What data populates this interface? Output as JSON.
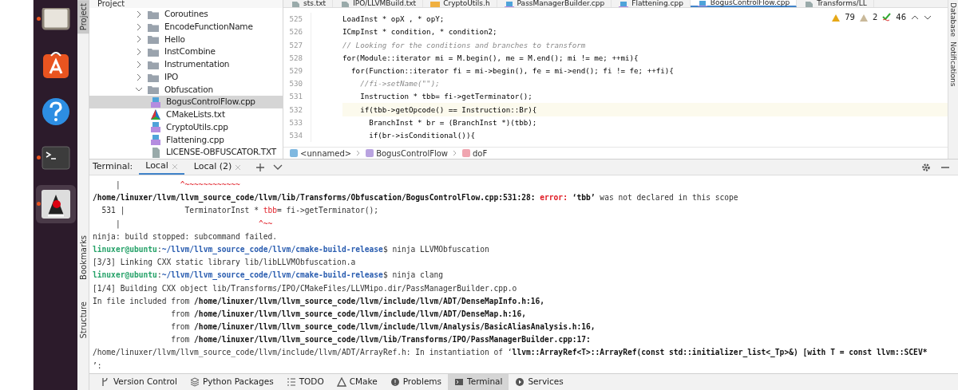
{
  "dock": {
    "items": [
      {
        "kind": "files",
        "running": true,
        "selected": false
      },
      {
        "kind": "store",
        "running": false,
        "selected": false
      },
      {
        "kind": "help",
        "running": false,
        "selected": false
      },
      {
        "kind": "terminal",
        "running": true,
        "selected": false
      },
      {
        "kind": "java",
        "running": true,
        "selected": true
      }
    ]
  },
  "side_strip": {
    "top": [
      {
        "label": "Project",
        "selected": true
      }
    ],
    "bottom": [
      {
        "label": "Bookmarks",
        "selected": false
      },
      {
        "label": "Structure",
        "selected": false
      }
    ]
  },
  "project": {
    "title": "Project",
    "tree": [
      {
        "label": "Coroutines",
        "kind": "folder",
        "expanded": false,
        "selected": false
      },
      {
        "label": "EncodeFunctionName",
        "kind": "folder",
        "expanded": false,
        "selected": false
      },
      {
        "label": "Hello",
        "kind": "folder",
        "expanded": false,
        "selected": false
      },
      {
        "label": "InstCombine",
        "kind": "folder",
        "expanded": false,
        "selected": false
      },
      {
        "label": "Instrumentation",
        "kind": "folder",
        "expanded": false,
        "selected": false
      },
      {
        "label": "IPO",
        "kind": "folder",
        "expanded": false,
        "selected": false
      },
      {
        "label": "Obfuscation",
        "kind": "folder",
        "expanded": true,
        "selected": false,
        "children": [
          {
            "label": "BogusControlFlow.cpp",
            "kind": "cpp",
            "selected": true
          },
          {
            "label": "CMakeLists.txt",
            "kind": "cmake",
            "selected": false
          },
          {
            "label": "CryptoUtils.cpp",
            "kind": "cpp",
            "selected": false
          },
          {
            "label": "Flattening.cpp",
            "kind": "cpp",
            "selected": false
          },
          {
            "label": "LICENSE-OBFUSCATOR.TXT",
            "kind": "text",
            "selected": false
          }
        ]
      }
    ]
  },
  "editor": {
    "tabs": [
      {
        "label": "sts.txt",
        "kind": "text",
        "selected": false
      },
      {
        "label": "IPO/LLVMBuild.txt",
        "kind": "text",
        "selected": false
      },
      {
        "label": "CryptoUtils.h",
        "kind": "h",
        "selected": false
      },
      {
        "label": "PassManagerBuilder.cpp",
        "kind": "cpp",
        "selected": false
      },
      {
        "label": "Flattening.cpp",
        "kind": "cpp",
        "selected": false
      },
      {
        "label": "BogusControlFlow.cpp",
        "kind": "cpp",
        "selected": true
      },
      {
        "label": "Transforms/LL",
        "kind": "text",
        "selected": false
      }
    ],
    "inspections": {
      "warnings": "79",
      "weak_warnings": "2",
      "typos": "46"
    },
    "lines": [
      {
        "number": "525",
        "text": "LoadInst * opX , * opY;",
        "kind": "code",
        "current": false
      },
      {
        "number": "526",
        "text": "ICmpInst * condition, * condition2;",
        "kind": "code",
        "current": false
      },
      {
        "number": "527",
        "text": "// Looking for the conditions and branches to transform",
        "kind": "comment",
        "current": false
      },
      {
        "number": "528",
        "text": "for(Module::iterator mi = M.begin(), me = M.end(); mi != me; ++mi){",
        "kind": "code",
        "current": false
      },
      {
        "number": "529",
        "text": "  for(Function::iterator fi = mi->begin(), fe = mi->end(); fi != fe; ++fi){",
        "kind": "code",
        "current": false
      },
      {
        "number": "530",
        "text": "    //fi->setName(\"\");",
        "kind": "comment",
        "current": false
      },
      {
        "number": "531",
        "text": "    Instruction * tbb= fi->getTerminator();",
        "kind": "code",
        "current": false
      },
      {
        "number": "532",
        "text": "    if(tbb->getOpcode() == Instruction::Br){",
        "kind": "code",
        "current": true
      },
      {
        "number": "533",
        "text": "      BranchInst * br = (BranchInst *)(tbb);",
        "kind": "code",
        "current": false
      },
      {
        "number": "534",
        "text": "      if(br->isConditional()){",
        "kind": "code",
        "current": false
      }
    ],
    "breadcrumbs": [
      {
        "label": "<unnamed>",
        "kind": "namespace"
      },
      {
        "label": "BogusControlFlow",
        "kind": "struct"
      },
      {
        "label": "doF",
        "kind": "function"
      }
    ]
  },
  "right_strip": [
    "Database",
    "Notifications"
  ],
  "terminal": {
    "title": "Terminal:",
    "tabs": [
      {
        "label": "Local",
        "selected": true
      },
      {
        "label": "Local (2)",
        "selected": false
      }
    ],
    "lines": [
      [
        {
          "text": "     |             ",
          "kind": "plain"
        },
        {
          "text": "^~~~~~~~~~~~~",
          "kind": "error"
        }
      ],
      [
        {
          "text": "/home/linuxer/llvm/llvm_source_code/llvm/lib/Transforms/Obfuscation/BogusControlFlow.cpp:531:28: ",
          "kind": "bold"
        },
        {
          "text": "error: ",
          "kind": "error-bold"
        },
        {
          "text": "‘tbb’",
          "kind": "bold"
        },
        {
          "text": " was not declared in this scope",
          "kind": "plain"
        }
      ],
      [
        {
          "text": "  531 |             TerminatorInst * ",
          "kind": "plain"
        },
        {
          "text": "tbb",
          "kind": "error"
        },
        {
          "text": "= fi->getTerminator();",
          "kind": "plain"
        }
      ],
      [
        {
          "text": "     |                              ",
          "kind": "plain"
        },
        {
          "text": "^~~",
          "kind": "error"
        }
      ],
      [
        {
          "text": "ninja: build stopped: subcommand failed.",
          "kind": "plain"
        }
      ],
      [
        {
          "text": "linuxer@ubuntu",
          "kind": "user"
        },
        {
          "text": ":",
          "kind": "plain"
        },
        {
          "text": "~/llvm/llvm_source_code/llvm/cmake-build-release",
          "kind": "path"
        },
        {
          "text": "$ ninja LLVMObfuscation",
          "kind": "plain"
        }
      ],
      [
        {
          "text": "[3/3] Linking CXX static library lib/libLLVMObfuscation.a",
          "kind": "plain"
        }
      ],
      [
        {
          "text": "linuxer@ubuntu",
          "kind": "user"
        },
        {
          "text": ":",
          "kind": "plain"
        },
        {
          "text": "~/llvm/llvm_source_code/llvm/cmake-build-release",
          "kind": "path"
        },
        {
          "text": "$ ninja clang",
          "kind": "plain"
        }
      ],
      [
        {
          "text": "[1/4] Building CXX object lib/Transforms/IPO/CMakeFiles/LLVMipo.dir/PassManagerBuilder.cpp.o",
          "kind": "plain"
        }
      ],
      [
        {
          "text": "In file included from ",
          "kind": "plain"
        },
        {
          "text": "/home/linuxer/llvm/llvm_source_code/llvm/include/llvm/ADT/DenseMapInfo.h:16,",
          "kind": "bold"
        }
      ],
      [
        {
          "text": "                 from ",
          "kind": "plain"
        },
        {
          "text": "/home/linuxer/llvm/llvm_source_code/llvm/include/llvm/ADT/DenseMap.h:16,",
          "kind": "bold"
        }
      ],
      [
        {
          "text": "                 from ",
          "kind": "plain"
        },
        {
          "text": "/home/linuxer/llvm/llvm_source_code/llvm/include/llvm/Analysis/BasicAliasAnalysis.h:16,",
          "kind": "bold"
        }
      ],
      [
        {
          "text": "                 from ",
          "kind": "plain"
        },
        {
          "text": "/home/linuxer/llvm/llvm_source_code/llvm/lib/Transforms/IPO/PassManagerBuilder.cpp:17:",
          "kind": "bold"
        }
      ],
      [
        {
          "text": "/home/linuxer/llvm/llvm_source_code/llvm/include/llvm/ADT/ArrayRef.h: In instantiation of ‘",
          "kind": "plain"
        },
        {
          "text": "llvm::ArrayRef<T>::ArrayRef(const std::initializer_list<_Tp>&) [with T = const llvm::SCEV*",
          "kind": "bold"
        }
      ],
      [
        {
          "text": "’:",
          "kind": "plain"
        }
      ]
    ]
  },
  "tool_windows": [
    {
      "label": "Version Control",
      "selected": false
    },
    {
      "label": "Python Packages",
      "selected": false
    },
    {
      "label": "TODO",
      "selected": false
    },
    {
      "label": "CMake",
      "selected": false
    },
    {
      "label": "Problems",
      "selected": false
    },
    {
      "label": "Terminal",
      "selected": true
    },
    {
      "label": "Services",
      "selected": false
    }
  ]
}
